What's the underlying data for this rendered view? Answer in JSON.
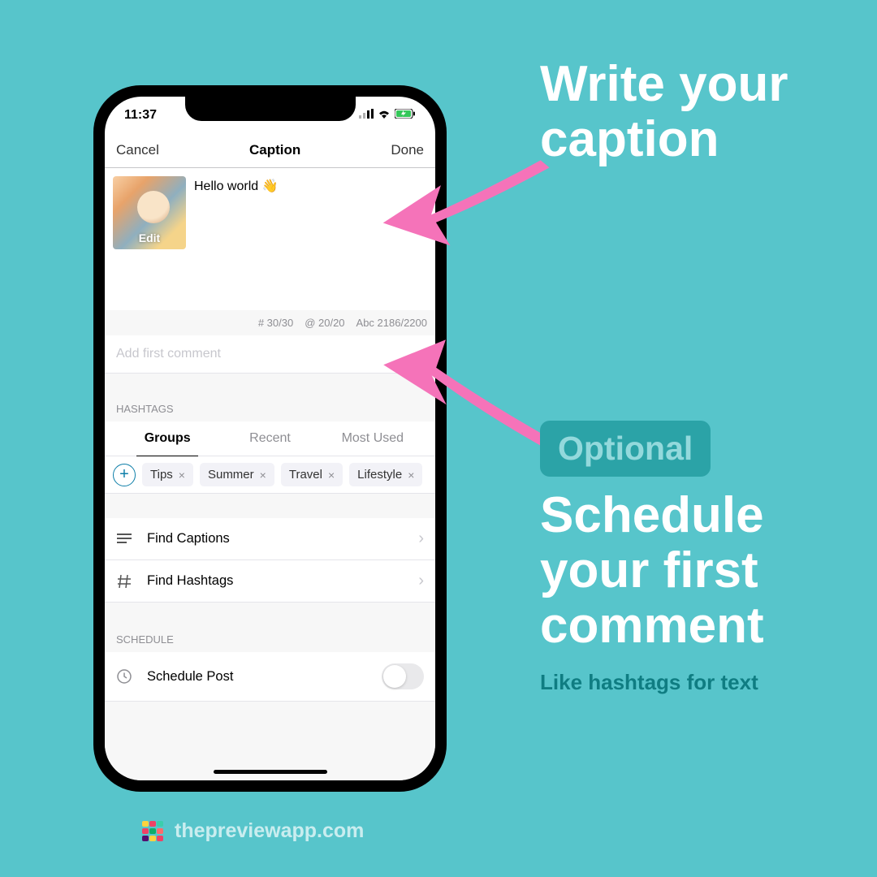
{
  "status": {
    "time": "11:37"
  },
  "nav": {
    "cancel": "Cancel",
    "title": "Caption",
    "done": "Done"
  },
  "caption": {
    "edit": "Edit",
    "text": "Hello world 👋"
  },
  "counters": {
    "hash": "# 30/30",
    "at": "@ 20/20",
    "abc": "Abc 2186/2200"
  },
  "firstComment": {
    "placeholder": "Add first comment"
  },
  "hashtags": {
    "header": "HASHTAGS",
    "tabs": {
      "groups": "Groups",
      "recent": "Recent",
      "mostUsed": "Most Used"
    },
    "tags": [
      "Tips",
      "Summer",
      "Travel",
      "Lifestyle"
    ]
  },
  "rows": {
    "findCaptions": "Find Captions",
    "findHashtags": "Find Hashtags"
  },
  "schedule": {
    "header": "SCHEDULE",
    "label": "Schedule Post"
  },
  "anno": {
    "writeCaption": "Write your caption",
    "optional": "Optional",
    "scheduleComment": "Schedule your first comment",
    "sub": "Like hashtags for text"
  },
  "footer": {
    "url": "thepreviewapp.com"
  }
}
